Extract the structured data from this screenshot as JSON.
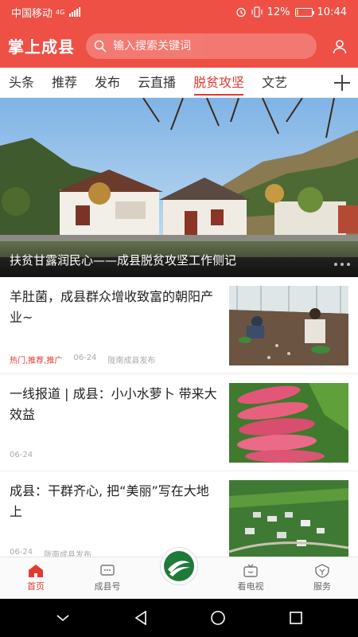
{
  "status_bar": {
    "carrier": "中国移动",
    "network": "4G",
    "battery_percent": "12%",
    "battery_level": 0.12,
    "time": "10:44"
  },
  "header": {
    "app_title": "掌上成县",
    "search_placeholder": "输入搜索关键词",
    "bg_color": "#ee5046"
  },
  "tabs": [
    {
      "label": "头条",
      "active": false
    },
    {
      "label": "推荐",
      "active": false
    },
    {
      "label": "发布",
      "active": false
    },
    {
      "label": "云直播",
      "active": false
    },
    {
      "label": "脱贫攻坚",
      "active": true
    },
    {
      "label": "文艺",
      "active": false
    }
  ],
  "hero": {
    "caption": "扶贫甘露润民心——成县脱贫攻坚工作侧记"
  },
  "news": [
    {
      "title": "羊肚菌，成县群众增收致富的朝阳产业~",
      "tags": "热门,推荐,推广",
      "date": "06-24",
      "source": "陇南成县发布",
      "thumb_icon": "greenhouse-photo"
    },
    {
      "title": "一线报道 | 成县：小小水萝卜 带来大效益",
      "tags": "",
      "date": "06-24",
      "source": "",
      "thumb_icon": "radish-photo"
    },
    {
      "title": "成县：干群齐心, 把“美丽”写在大地上",
      "tags": "",
      "date": "06-24",
      "source": "陇南成县发布",
      "thumb_icon": "village-aerial-photo"
    }
  ],
  "bottom_nav": [
    {
      "label": "首页",
      "icon": "home-icon",
      "active": true
    },
    {
      "label": "成县号",
      "icon": "chat-bubble-icon",
      "active": false
    },
    {
      "label": "看电视",
      "icon": "tv-icon",
      "active": false
    },
    {
      "label": "服务",
      "icon": "service-shield-icon",
      "active": false
    }
  ],
  "colors": {
    "accent": "#e33a30",
    "header": "#ee5046",
    "logo_green": "#1f7a3a"
  }
}
